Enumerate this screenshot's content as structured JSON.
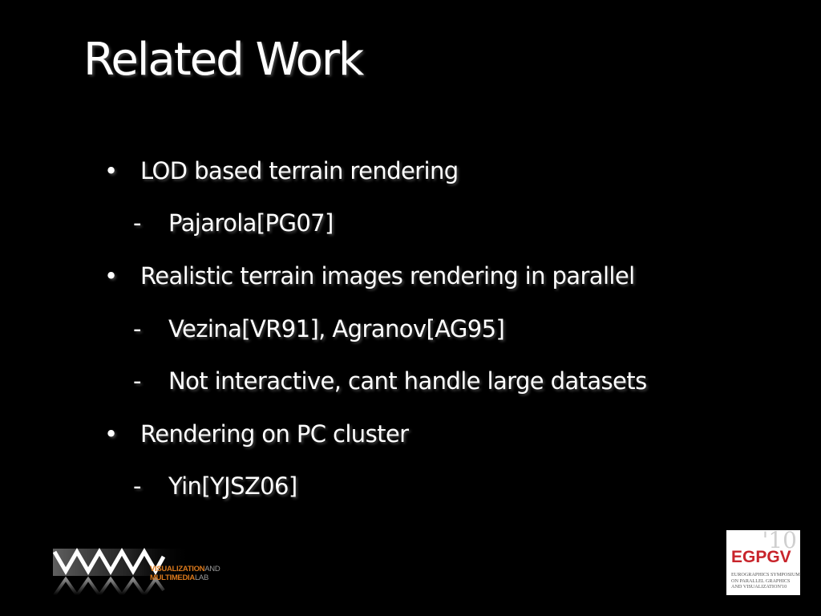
{
  "slide": {
    "title": "Related Work",
    "bullet_marker": "•",
    "sub_marker": "-",
    "items": [
      {
        "level": 1,
        "text": "LOD based terrain rendering"
      },
      {
        "level": 2,
        "text": "Pajarola[PG07]"
      },
      {
        "level": 1,
        "text": "Realistic terrain images rendering in parallel"
      },
      {
        "level": 2,
        "text": "Vezina[VR91], Agranov[AG95]"
      },
      {
        "level": 2,
        "text": "Not interactive, cant handle large datasets"
      },
      {
        "level": 1,
        "text": "Rendering on PC cluster"
      },
      {
        "level": 2,
        "text": "Yin[YJSZ06]"
      }
    ]
  },
  "logos": {
    "vml": {
      "line1_a": "VISUALIZATION",
      "line1_b": "AND",
      "line2_a": "MULTIMEDIA",
      "line2_b": "LAB",
      "accent_color": "#d9781c"
    },
    "egpgv": {
      "name": "EGPGV",
      "year": "'10",
      "sub_line1": "Eurographics Symposium",
      "sub_line2": "on Parallel Graphics",
      "sub_line3": "and Visualization'10",
      "accent_color": "#c8242b"
    }
  }
}
